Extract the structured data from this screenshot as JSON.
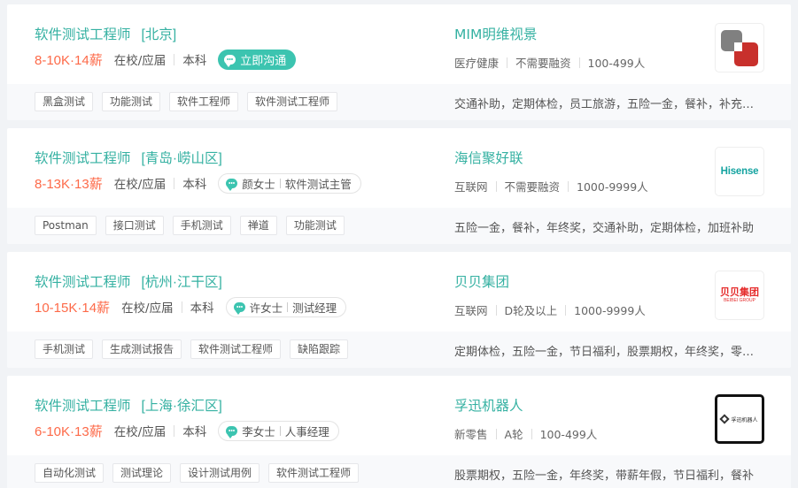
{
  "jobs": [
    {
      "title": "软件测试工程师",
      "area": "[北京]",
      "salary": "8-10K·14薪",
      "experience": "在校/应届",
      "degree": "本科",
      "chat": "立即沟通",
      "company": "MIM明维视景",
      "industry": "医疗健康",
      "stage": "不需要融资",
      "size": "100-499人",
      "skills": [
        "黑盒测试",
        "功能测试",
        "软件工程师",
        "软件测试工程师"
      ],
      "welfare": "交通补助，定期体检，员工旅游，五险一金，餐补，补充医疗保险"
    },
    {
      "title": "软件测试工程师",
      "area": "[青岛·崂山区]",
      "salary": "8-13K·13薪",
      "experience": "在校/应届",
      "degree": "本科",
      "recruiter_name": "颜女士",
      "recruiter_title": "软件测试主管",
      "company": "海信聚好联",
      "industry": "互联网",
      "stage": "不需要融资",
      "size": "1000-9999人",
      "logo_text": "Hisense",
      "skills": [
        "Postman",
        "接口测试",
        "手机测试",
        "禅道",
        "功能测试"
      ],
      "welfare": "五险一金，餐补，年终奖，交通补助，定期体检，加班补助"
    },
    {
      "title": "软件测试工程师",
      "area": "[杭州·江干区]",
      "salary": "10-15K·14薪",
      "experience": "在校/应届",
      "degree": "本科",
      "recruiter_name": "许女士",
      "recruiter_title": "测试经理",
      "company": "贝贝集团",
      "industry": "互联网",
      "stage": "D轮及以上",
      "size": "1000-9999人",
      "logo_text": "贝贝集团",
      "logo_subtext": "BEIBEI GROUP",
      "skills": [
        "手机测试",
        "生成测试报告",
        "软件测试工程师",
        "缺陷跟踪"
      ],
      "welfare": "定期体检，五险一金，节日福利，股票期权，年终奖，零食下午茶"
    },
    {
      "title": "软件测试工程师",
      "area": "[上海·徐汇区]",
      "salary": "6-10K·13薪",
      "experience": "在校/应届",
      "degree": "本科",
      "recruiter_name": "李女士",
      "recruiter_title": "人事经理",
      "company": "孚迅机器人",
      "industry": "新零售",
      "stage": "A轮",
      "size": "100-499人",
      "logo_text": "孚迅机器人",
      "skills": [
        "自动化测试",
        "测试理论",
        "设计测试用例",
        "软件测试工程师"
      ],
      "welfare": "股票期权，五险一金，年终奖，带薪年假，节日福利，餐补"
    }
  ]
}
